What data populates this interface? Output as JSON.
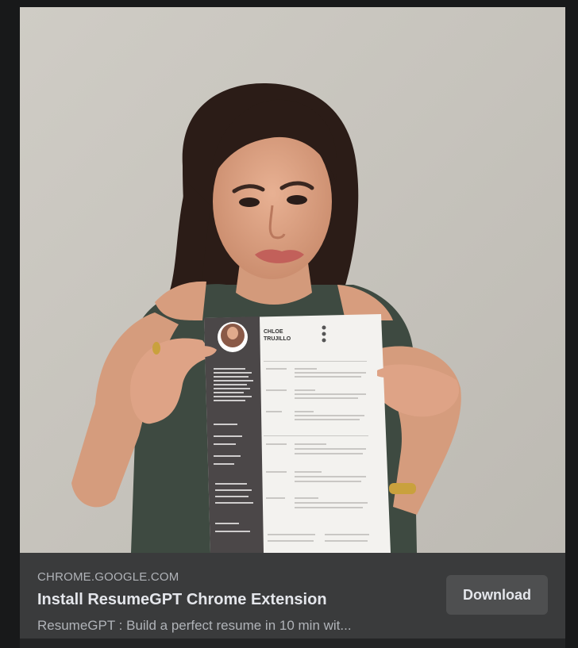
{
  "ad": {
    "image_alt": "Woman holding a printed resume",
    "resume": {
      "first_name": "CHLOE",
      "last_name": "TRUJILLO"
    },
    "domain": "CHROME.GOOGLE.COM",
    "headline": "Install ResumeGPT Chrome Extension",
    "description": "ResumeGPT : Build a perfect resume in 10 min wit...",
    "cta_label": "Download"
  },
  "colors": {
    "page_bg": "#18191a",
    "card_bg": "#242526",
    "cta_bar_bg": "#3a3b3c",
    "button_bg": "#4e4f50",
    "primary_text": "#e4e6eb",
    "secondary_text": "#b0b3b8"
  }
}
